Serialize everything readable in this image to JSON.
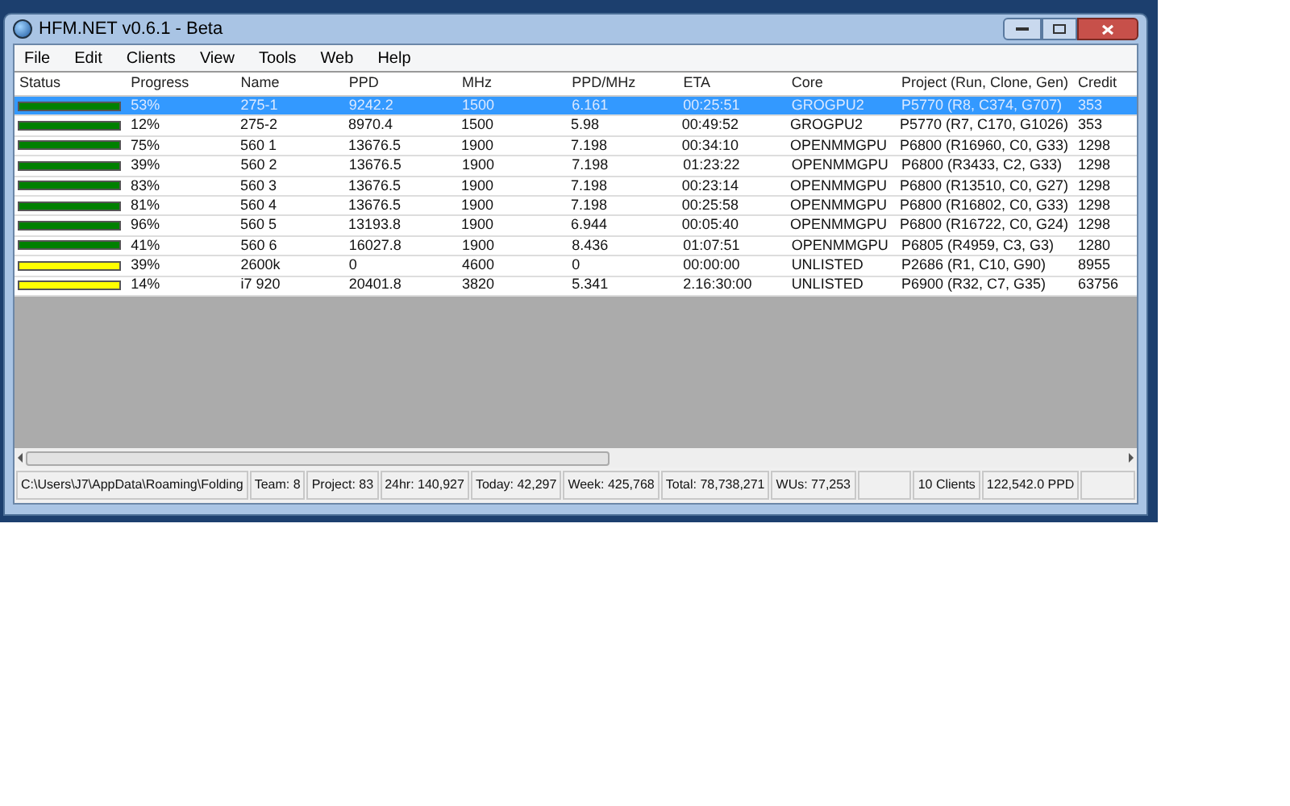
{
  "window": {
    "title": "HFM.NET v0.6.1 - Beta"
  },
  "menu": [
    "File",
    "Edit",
    "Clients",
    "View",
    "Tools",
    "Web",
    "Help"
  ],
  "table": {
    "status_header": "Status",
    "columns": [
      "Progress",
      "Name",
      "PPD",
      "MHz",
      "PPD/MHz",
      "ETA",
      "Core",
      "Project (Run, Clone, Gen)",
      "Credit"
    ],
    "rows": [
      {
        "selected": true,
        "color": "#008000",
        "cells": [
          "53%",
          "275-1",
          "9242.2",
          "1500",
          "6.161",
          "00:25:51",
          "GROGPU2",
          "P5770 (R8, C374, G707)",
          "353"
        ]
      },
      {
        "selected": false,
        "color": "#008000",
        "cells": [
          "12%",
          "275-2",
          "8970.4",
          "1500",
          "5.98",
          "00:49:52",
          "GROGPU2",
          "P5770 (R7, C170, G1026)",
          "353"
        ]
      },
      {
        "selected": false,
        "color": "#008000",
        "cells": [
          "75%",
          "560 1",
          "13676.5",
          "1900",
          "7.198",
          "00:34:10",
          "OPENMMGPU",
          "P6800 (R16960, C0, G33)",
          "1298"
        ]
      },
      {
        "selected": false,
        "color": "#008000",
        "cells": [
          "39%",
          "560 2",
          "13676.5",
          "1900",
          "7.198",
          "01:23:22",
          "OPENMMGPU",
          "P6800 (R3433, C2, G33)",
          "1298"
        ]
      },
      {
        "selected": false,
        "color": "#008000",
        "cells": [
          "83%",
          "560 3",
          "13676.5",
          "1900",
          "7.198",
          "00:23:14",
          "OPENMMGPU",
          "P6800 (R13510, C0, G27)",
          "1298"
        ]
      },
      {
        "selected": false,
        "color": "#008000",
        "cells": [
          "81%",
          "560 4",
          "13676.5",
          "1900",
          "7.198",
          "00:25:58",
          "OPENMMGPU",
          "P6800 (R16802, C0, G33)",
          "1298"
        ]
      },
      {
        "selected": false,
        "color": "#008000",
        "cells": [
          "96%",
          "560 5",
          "13193.8",
          "1900",
          "6.944",
          "00:05:40",
          "OPENMMGPU",
          "P6800 (R16722, C0, G24)",
          "1298"
        ]
      },
      {
        "selected": false,
        "color": "#008000",
        "cells": [
          "41%",
          "560 6",
          "16027.8",
          "1900",
          "8.436",
          "01:07:51",
          "OPENMMGPU",
          "P6805 (R4959, C3, G3)",
          "1280"
        ]
      },
      {
        "selected": false,
        "color": "#ffff00",
        "cells": [
          "39%",
          "2600k",
          "0",
          "4600",
          "0",
          "00:00:00",
          "UNLISTED",
          "P2686 (R1, C10, G90)",
          "8955"
        ]
      },
      {
        "selected": false,
        "color": "#ffff00",
        "cells": [
          "14%",
          "i7 920",
          "20401.8",
          "3820",
          "5.341",
          "2.16:30:00",
          "UNLISTED",
          "P6900 (R32, C7, G35)",
          "63756"
        ]
      }
    ]
  },
  "status_bar": [
    "C:\\Users\\J7\\AppData\\Roaming\\Folding",
    "Team: 8",
    "Project: 83",
    "24hr: 140,927",
    "Today: 42,297",
    "Week: 425,768",
    "Total: 78,738,271",
    "WUs: 77,253",
    "10 Clients",
    "122,542.0 PPD"
  ]
}
